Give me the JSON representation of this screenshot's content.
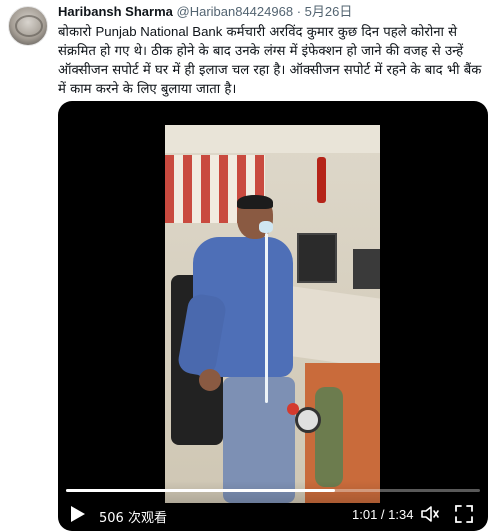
{
  "tweet": {
    "author_name": "Haribansh Sharma",
    "handle": "@Hariban84424968",
    "separator": "·",
    "date": "5月26日",
    "text_line1_prefix": "बोकारो ",
    "text_line1_bank": "Punjab National Bank",
    "text_line1_suffix": " कर्मचारी अरविंद कुमार कुछ दिन पहले कोरोना से",
    "text_line2": "संक्रमित हो गए थे। ठीक होने के बाद उनके लंग्स में इंफेक्शन हो जाने की वजह से उन्हें",
    "text_line3": "ऑक्सीजन सपोर्ट में घर में ही इलाज चल रहा है। ऑक्सीजन सपोर्ट में रहने के बाद भी बैंक",
    "text_line4": "में काम करने के लिए बुलाया जाता है।"
  },
  "video": {
    "views": "506 次观看",
    "time": "1:01 / 1:34",
    "progress": 0.649,
    "icons": [
      "play-icon",
      "volume-icon",
      "fullscreen-icon"
    ]
  },
  "colors": {
    "text": "#0f1419",
    "secondary": "#536471",
    "media_bg": "#000000"
  }
}
